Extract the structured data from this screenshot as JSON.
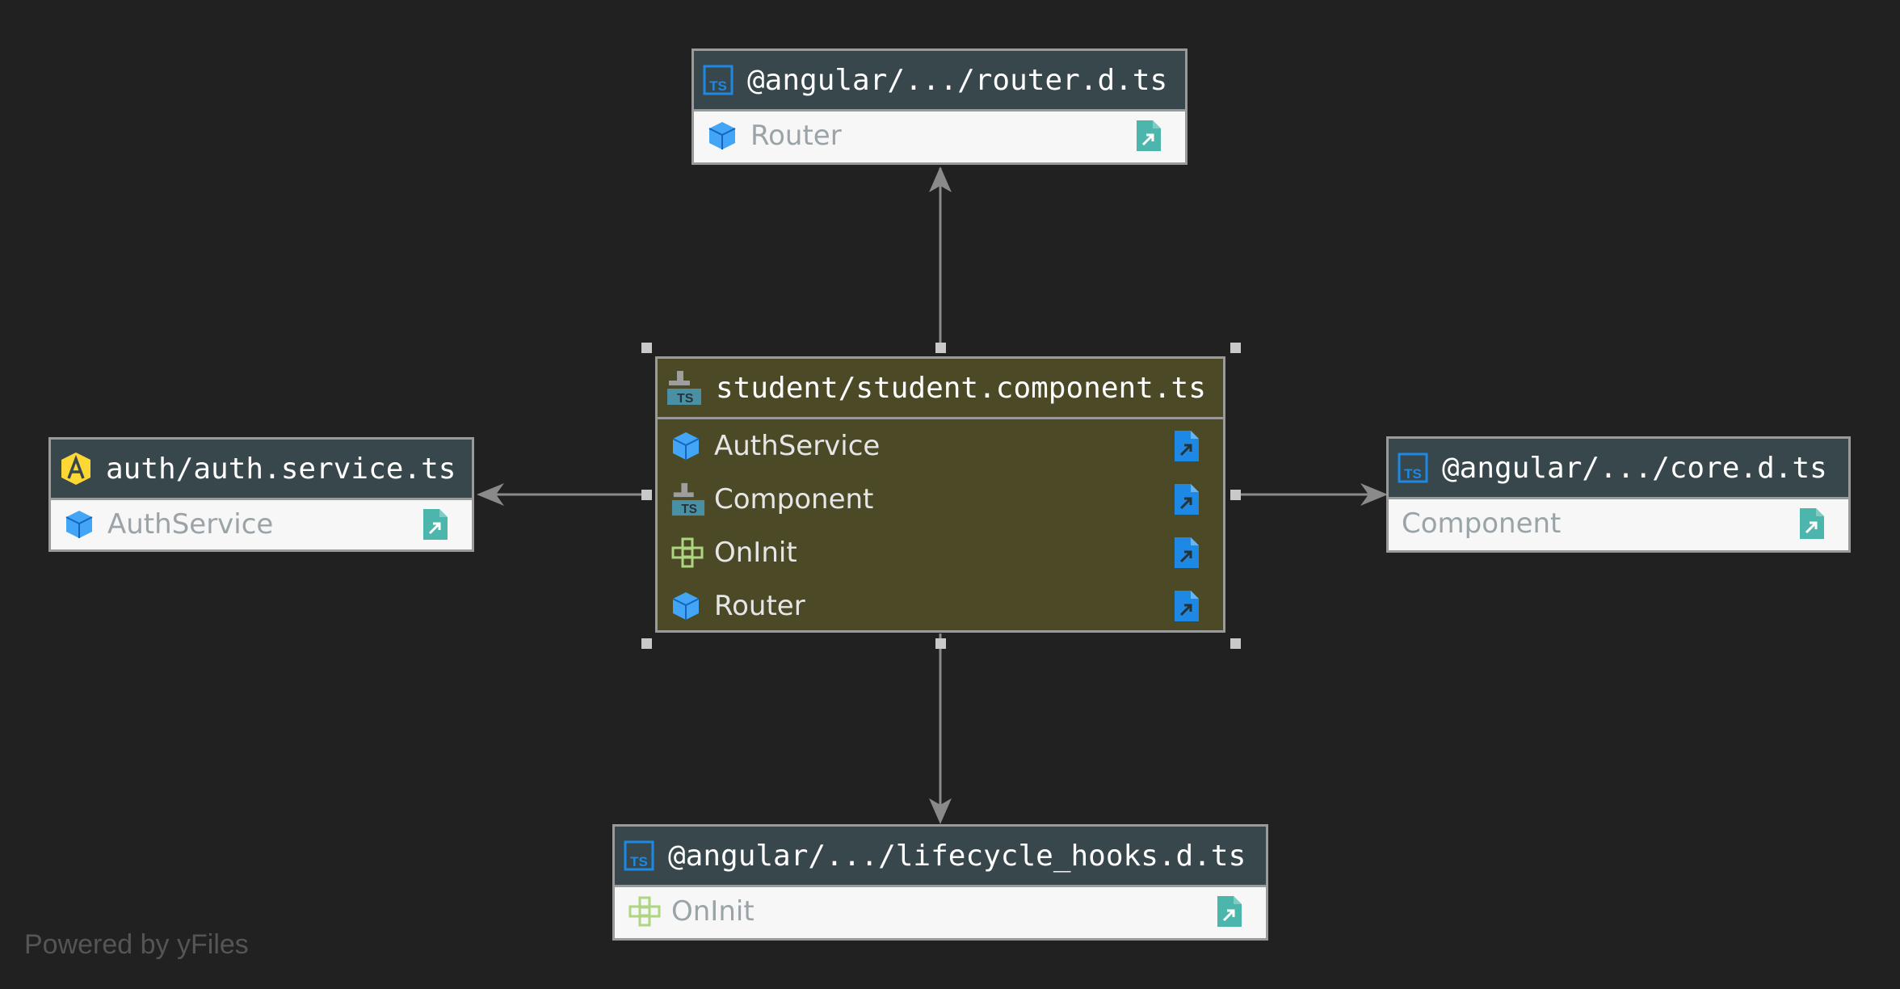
{
  "nodes": {
    "center": {
      "title": "student/student.component.ts",
      "file_icon": "ts-component-file-icon",
      "rows": [
        {
          "label": "AuthService",
          "icon": "class-cube-icon"
        },
        {
          "label": "Component",
          "icon": "ts-component-file-icon"
        },
        {
          "label": "OnInit",
          "icon": "interface-icon"
        },
        {
          "label": "Router",
          "icon": "class-cube-icon"
        }
      ]
    },
    "router": {
      "title": "@angular/.../router.d.ts",
      "file_icon": "typescript-file-icon",
      "rows": [
        {
          "label": "Router",
          "icon": "class-cube-icon"
        }
      ]
    },
    "auth": {
      "title": "auth/auth.service.ts",
      "file_icon": "angular-icon",
      "rows": [
        {
          "label": "AuthService",
          "icon": "class-cube-icon"
        }
      ]
    },
    "core": {
      "title": "@angular/.../core.d.ts",
      "file_icon": "typescript-file-icon",
      "rows": [
        {
          "label": "Component",
          "icon": "none"
        }
      ]
    },
    "lifecycle": {
      "title": "@angular/.../lifecycle_hooks.d.ts",
      "file_icon": "typescript-file-icon",
      "rows": [
        {
          "label": "OnInit",
          "icon": "interface-icon"
        }
      ]
    }
  },
  "colors": {
    "background": "#212121",
    "header": "#37474c",
    "center_fill": "#4c4a26",
    "edge": "#8a8a8a",
    "ts_blue": "#1e88e5",
    "cube_blue": "#42a5f5",
    "nav_teal": "#4db6ac",
    "interface_green": "#aed581",
    "angular_yellow": "#fdd835"
  },
  "footer": {
    "powered_by": "Powered by yFiles"
  }
}
